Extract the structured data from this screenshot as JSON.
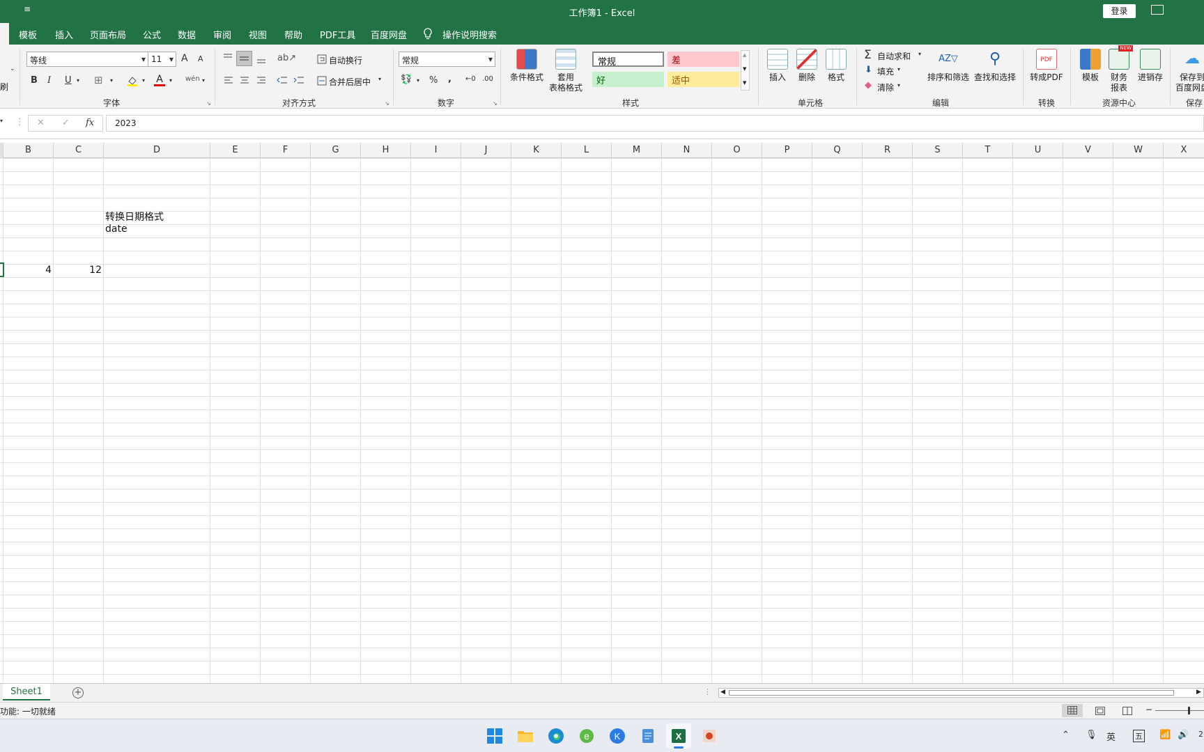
{
  "window": {
    "qat_glyph": "≡",
    "title": "工作簿1  -  Excel",
    "login_label": "登录",
    "restore_glyph": "▭"
  },
  "menu": {
    "tabs": [
      "模板",
      "插入",
      "页面布局",
      "公式",
      "数据",
      "审阅",
      "视图",
      "帮助",
      "PDF工具",
      "百度网盘"
    ],
    "search_label": "操作说明搜索"
  },
  "ribbon": {
    "clipboard_fragment": "刷",
    "font": {
      "group_label": "字体",
      "font_name": "等线",
      "font_size": "11",
      "bold": "B",
      "italic": "I",
      "underline": "U",
      "grow": "A",
      "shrink": "A",
      "fontcolor": "A",
      "phonetic": "wén"
    },
    "alignment": {
      "group_label": "对齐方式",
      "wrap_text": "自动换行",
      "merge_center": "合并后居中"
    },
    "number": {
      "group_label": "数字",
      "format": "常规",
      "percent": "%",
      "comma": ","
    },
    "styles": {
      "group_label": "样式",
      "conditional": "条件格式",
      "table_format_1": "套用",
      "table_format_2": "表格格式",
      "normal": "常规",
      "bad": "差",
      "good": "好",
      "neutral": "适中"
    },
    "cells": {
      "group_label": "单元格",
      "insert": "插入",
      "delete": "删除",
      "format": "格式"
    },
    "editing": {
      "group_label": "编辑",
      "autosum": "自动求和",
      "fill": "填充",
      "clear": "清除",
      "sort_filter": "排序和筛选",
      "find_select": "查找和选择"
    },
    "convert": {
      "group_label": "转换",
      "to_pdf": "转成PDF"
    },
    "resources": {
      "group_label": "资源中心",
      "template": "模板",
      "finance_1": "财务",
      "finance_2": "报表",
      "inventory": "进销存",
      "new_badge": "NEW"
    },
    "save": {
      "group_label": "保存",
      "save_1": "保存到",
      "save_2": "百度网盘"
    }
  },
  "formula_bar": {
    "cancel": "✕",
    "enter": "✓",
    "fx": "fx",
    "value": "2023"
  },
  "columns": [
    "B",
    "C",
    "D",
    "E",
    "F",
    "G",
    "H",
    "I",
    "J",
    "K",
    "L",
    "M",
    "N",
    "O",
    "P",
    "Q",
    "R",
    "S",
    "T",
    "U",
    "V",
    "W",
    "X"
  ],
  "cells": {
    "d4": "转换日期格式",
    "d5": "date",
    "b8": "4",
    "c8": "12"
  },
  "sheets": {
    "tabs": [
      "Sheet1"
    ],
    "add": "+"
  },
  "status": {
    "text": "功能: 一切就绪"
  },
  "taskbar": {
    "ime": "英",
    "ime2": "五",
    "clock_fragment": "2"
  },
  "colors": {
    "brand": "#217346",
    "bad_bg": "#ffc7ce",
    "bad_fg": "#9c0006",
    "good_bg": "#c6efce",
    "good_fg": "#006100",
    "neutral_bg": "#ffeb9c",
    "neutral_fg": "#9c5700"
  }
}
